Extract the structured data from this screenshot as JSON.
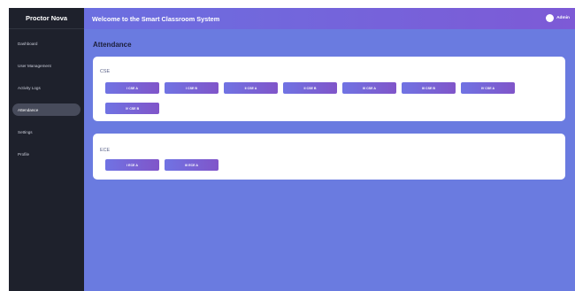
{
  "app": {
    "brand": "Proctor Nova",
    "header_title": "Welcome to the Smart Classroom System",
    "user_label": "Admin"
  },
  "sidebar": {
    "items": [
      {
        "label": "Dashboard",
        "active": false
      },
      {
        "label": "User Management",
        "active": false
      },
      {
        "label": "Activity Logs",
        "active": false
      },
      {
        "label": "Attendance",
        "active": true
      },
      {
        "label": "Settings",
        "active": false
      },
      {
        "label": "Profile",
        "active": false
      }
    ]
  },
  "main": {
    "page_title": "Attendance",
    "departments": [
      {
        "name": "CSE",
        "classes": [
          "I CSE A",
          "I CSE B",
          "II CSE A",
          "II CSE B",
          "III CSE A",
          "III CSE B",
          "IV CSE A",
          "IV CSE B"
        ]
      },
      {
        "name": "ECE",
        "classes": [
          "I ECE A",
          "III ECE A"
        ]
      }
    ]
  },
  "colors": {
    "sidebar_bg": "#1e212c",
    "content_bg": "#6a7be0",
    "header_gradient_start": "#6b6fe0",
    "header_gradient_end": "#7d5ad6",
    "button_gradient_start": "#7073e3",
    "button_gradient_end": "#8055c9"
  }
}
